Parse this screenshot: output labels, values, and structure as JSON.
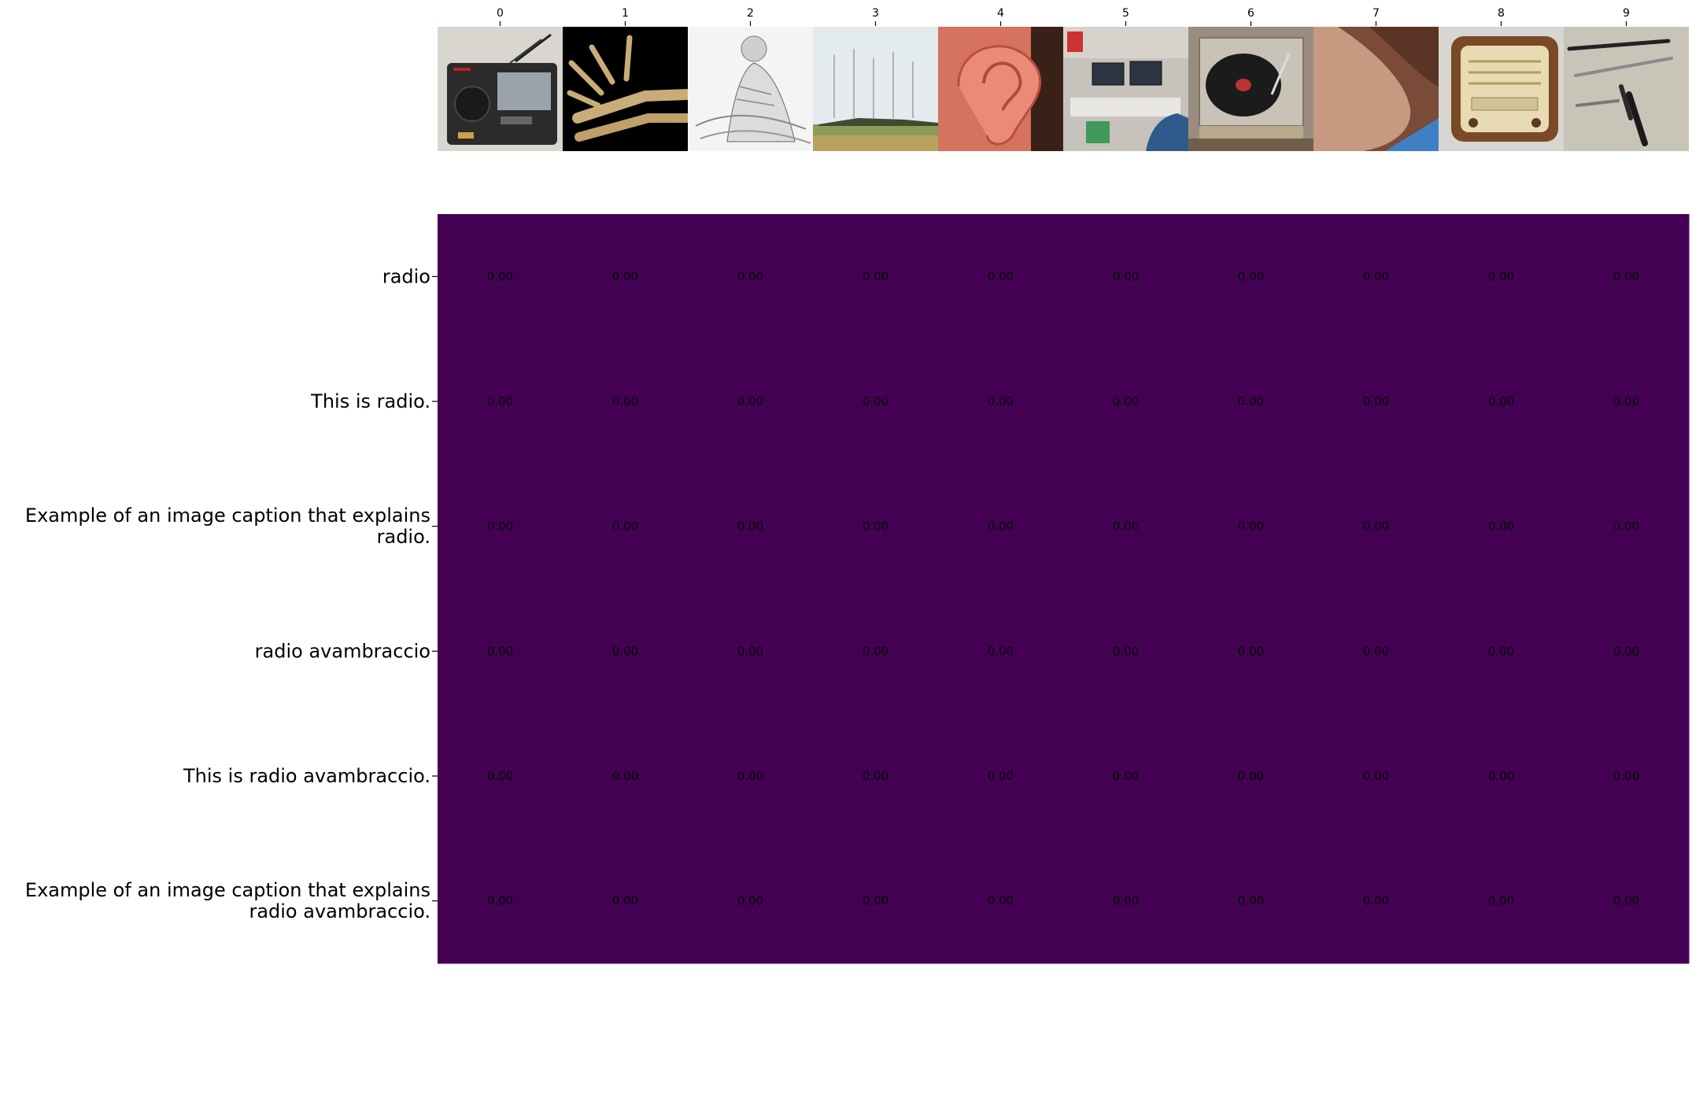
{
  "chart_data": {
    "type": "heatmap",
    "colormap": "viridis",
    "cell_color": "#440154",
    "x_tick_labels": [
      "0",
      "1",
      "2",
      "3",
      "4",
      "5",
      "6",
      "7",
      "8",
      "9"
    ],
    "image_thumbnails": [
      {
        "index": "0",
        "subject": "portable radio",
        "icon": "radio-icon"
      },
      {
        "index": "1",
        "subject": "skeletal hand and forearm bones",
        "icon": "bones-icon"
      },
      {
        "index": "2",
        "subject": "engraving of a woman",
        "icon": "engraving-icon"
      },
      {
        "index": "3",
        "subject": "radio antenna field",
        "icon": "antenna-field-icon"
      },
      {
        "index": "4",
        "subject": "human ear",
        "icon": "ear-icon"
      },
      {
        "index": "5",
        "subject": "radio studio",
        "icon": "studio-icon"
      },
      {
        "index": "6",
        "subject": "turntable",
        "icon": "turntable-icon"
      },
      {
        "index": "7",
        "subject": "bent elbow",
        "icon": "elbow-icon"
      },
      {
        "index": "8",
        "subject": "vintage radio",
        "icon": "vintage-radio-icon"
      },
      {
        "index": "9",
        "subject": "surgical instruments",
        "icon": "instruments-icon"
      }
    ],
    "y_tick_labels": [
      [
        "radio"
      ],
      [
        "This is radio."
      ],
      [
        "Example of an image caption that explains",
        "radio."
      ],
      [
        "radio avambraccio"
      ],
      [
        "This is radio avambraccio."
      ],
      [
        "Example of an image caption that explains",
        "radio avambraccio."
      ]
    ],
    "values": [
      [
        0,
        0,
        0,
        0,
        0,
        0,
        0,
        0,
        0,
        0
      ],
      [
        0,
        0,
        0,
        0,
        0,
        0,
        0,
        0,
        0,
        0
      ],
      [
        0,
        0,
        0,
        0,
        0,
        0,
        0,
        0,
        0,
        0
      ],
      [
        0,
        0,
        0,
        0,
        0,
        0,
        0,
        0,
        0,
        0
      ],
      [
        0,
        0,
        0,
        0,
        0,
        0,
        0,
        0,
        0,
        0
      ],
      [
        0,
        0,
        0,
        0,
        0,
        0,
        0,
        0,
        0,
        0
      ]
    ],
    "value_format": "0.00"
  }
}
